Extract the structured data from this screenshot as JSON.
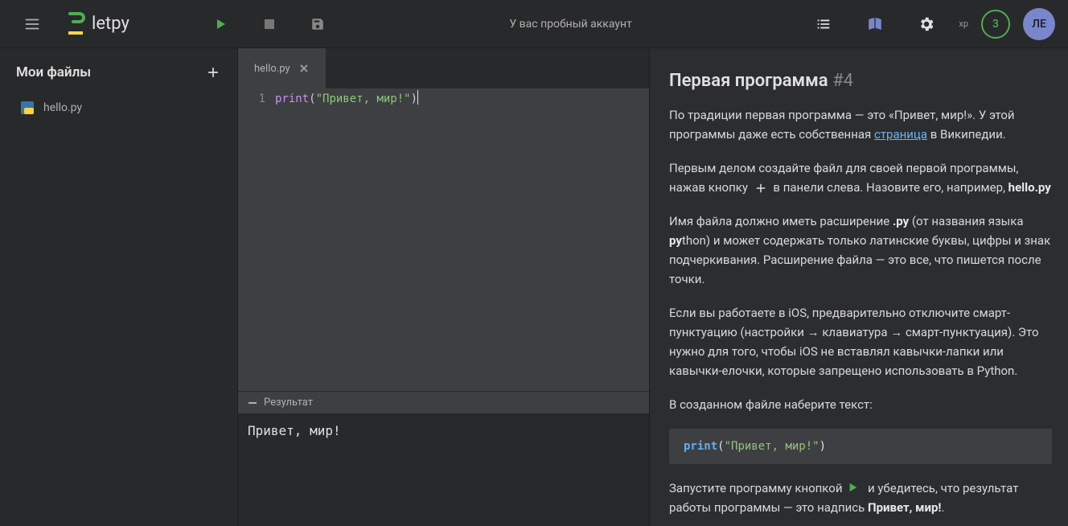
{
  "header": {
    "brand": "letpy",
    "trial_text": "У вас пробный аккаунт",
    "xp_label": "xp",
    "xp_value": "3",
    "avatar_initials": "ЛЕ"
  },
  "sidebar": {
    "title": "Мои файлы",
    "files": [
      {
        "name": "hello.py"
      }
    ]
  },
  "editor": {
    "tab": {
      "label": "hello.py"
    },
    "line_number": "1",
    "code": {
      "fn": "print",
      "open": "(",
      "str": "\"Привет, мир!\"",
      "close": ")"
    },
    "result_label": "Результат",
    "result_output": "Привет, мир!"
  },
  "lesson": {
    "title": "Первая программа",
    "number": "#4",
    "p1_a": "По традиции первая программа — это «Привет, мир!». У этой программы даже есть собственная ",
    "p1_link": "страница",
    "p1_b": " в Википедии.",
    "p2_a": "Первым делом создайте файл для своей первой программы, нажав кнопку ",
    "p2_b": " в панели слева. Назовите его, например, ",
    "p2_bold": "hello.py",
    "p3_a": "Имя файла должно иметь расширение ",
    "p3_bold1": ".py",
    "p3_b": " (от названия языка ",
    "p3_bold2": "py",
    "p3_c": "thon) и может содержать только латинские буквы, цифры и знак подчеркивания. Расширение файла — это все, что пишется после точки.",
    "p4": "Если вы работаете в iOS, предварительно отключите смарт-пунктуацию (настройки → клавиатура → смарт-пунктуация). Это нужно для того, чтобы iOS не вставлял кавычки-лапки или кавычки-елочки, которые запрещено использовать в Python.",
    "p5": "В созданном файле наберите текст:",
    "code": {
      "fn": "print",
      "open": "(",
      "str": "\"Привет, мир!\"",
      "close": ")"
    },
    "p6_a": "Запустите программу кнопкой ",
    "p6_b": " и убедитесь, что результат работы программы — это надпись ",
    "p6_bold": "Привет, мир!",
    "p6_c": "."
  }
}
